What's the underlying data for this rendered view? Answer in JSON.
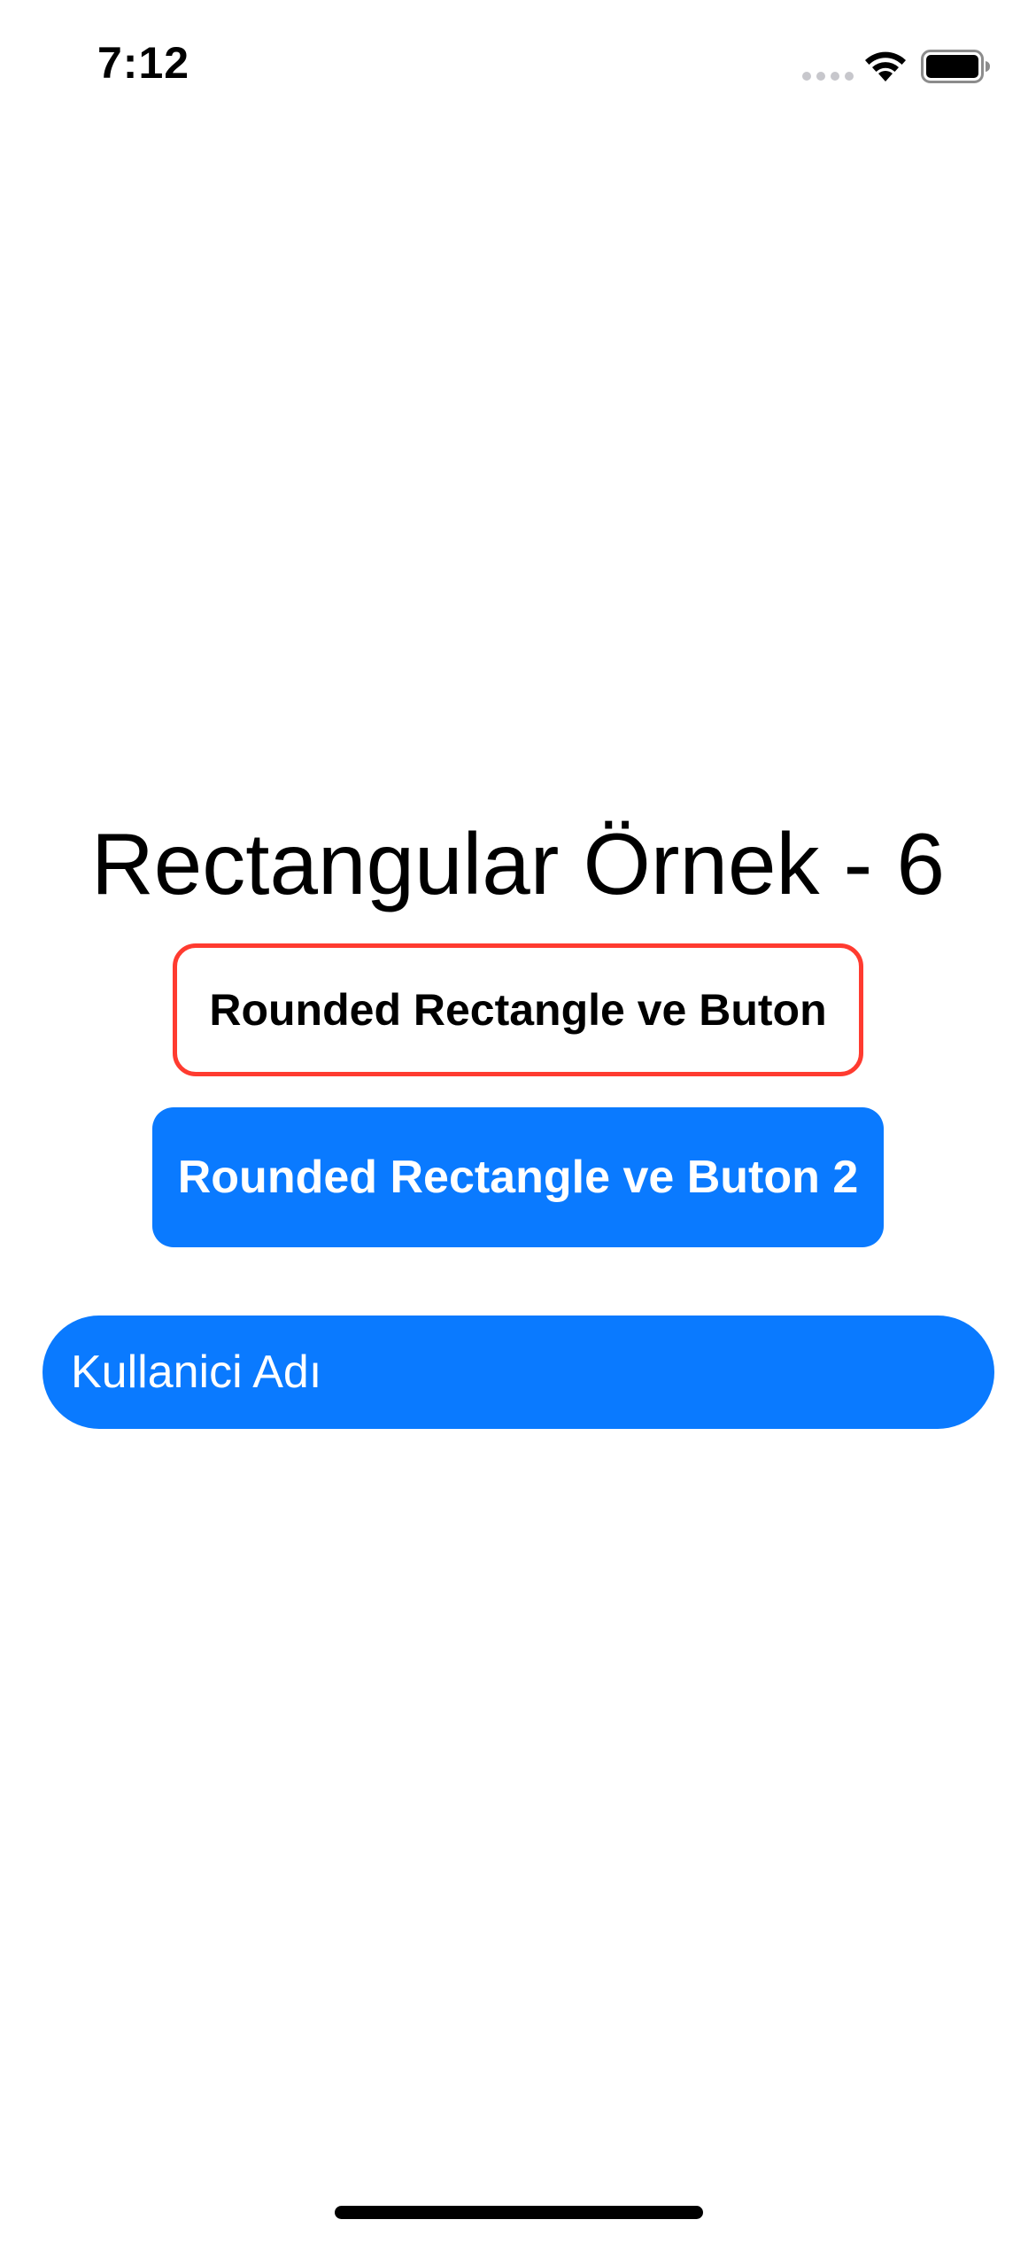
{
  "status_bar": {
    "time": "7:12",
    "icons": [
      "signal-icon",
      "wifi-icon",
      "battery-icon"
    ]
  },
  "main": {
    "title": "Rectangular Örnek - 6",
    "outlined_button_label": "Rounded Rectangle ve Buton",
    "filled_button_label": "Rounded Rectangle ve Buton 2",
    "username_field": {
      "value": "",
      "placeholder": "Kullanici Adı"
    }
  },
  "colors": {
    "accent_blue": "#0a7aff",
    "outline_red": "#ff3b30",
    "background": "#ffffff",
    "text": "#000000"
  }
}
